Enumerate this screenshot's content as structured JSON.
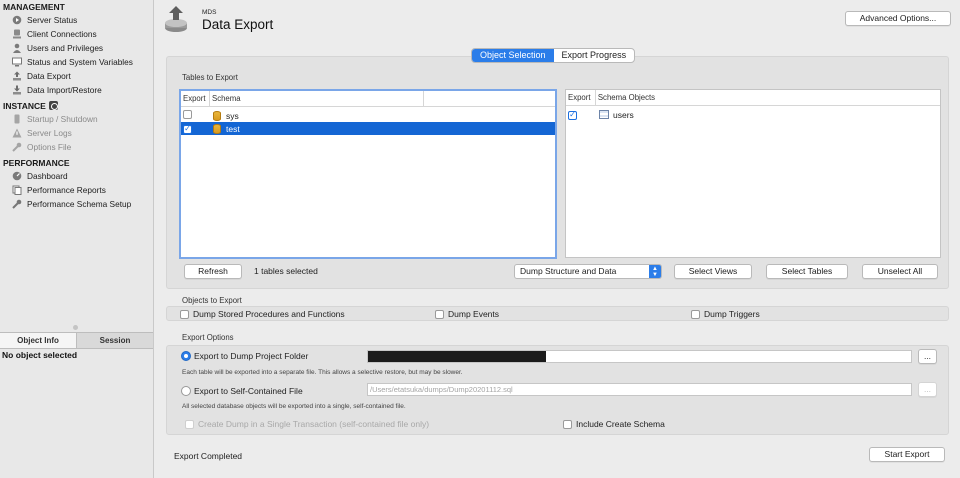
{
  "sidebar": {
    "management": {
      "title": "MANAGEMENT",
      "items": [
        {
          "label": "Server Status",
          "icon": "server-status-icon"
        },
        {
          "label": "Client Connections",
          "icon": "client-connections-icon"
        },
        {
          "label": "Users and Privileges",
          "icon": "user-icon"
        },
        {
          "label": "Status and System Variables",
          "icon": "monitor-icon"
        },
        {
          "label": "Data Export",
          "icon": "data-export-icon"
        },
        {
          "label": "Data Import/Restore",
          "icon": "data-import-icon"
        }
      ]
    },
    "instance": {
      "title": "INSTANCE",
      "items": [
        {
          "label": "Startup / Shutdown",
          "icon": "startup-icon"
        },
        {
          "label": "Server Logs",
          "icon": "warning-icon"
        },
        {
          "label": "Options File",
          "icon": "wrench-icon"
        }
      ]
    },
    "performance": {
      "title": "PERFORMANCE",
      "items": [
        {
          "label": "Dashboard",
          "icon": "dashboard-icon"
        },
        {
          "label": "Performance Reports",
          "icon": "reports-icon"
        },
        {
          "label": "Performance Schema Setup",
          "icon": "schema-setup-icon"
        }
      ]
    },
    "tabs": {
      "object_info": "Object Info",
      "session": "Session"
    },
    "no_object": "No object selected"
  },
  "header": {
    "subtitle": "MDS",
    "title": "Data Export",
    "advanced_options": "Advanced Options..."
  },
  "tabs": {
    "object_selection": "Object Selection",
    "export_progress": "Export Progress"
  },
  "tables_to_export": {
    "label": "Tables to Export",
    "left": {
      "col_export": "Export",
      "col_schema": "Schema",
      "rows": [
        {
          "name": "sys",
          "checked": false,
          "selected": false
        },
        {
          "name": "test",
          "checked": true,
          "selected": true
        }
      ]
    },
    "right": {
      "col_export": "Export",
      "col_objects": "Schema Objects",
      "rows": [
        {
          "name": "users",
          "checked": true
        }
      ]
    },
    "refresh": "Refresh",
    "selected_count": "1 tables selected",
    "dump_mode": "Dump Structure and Data",
    "select_views": "Select Views",
    "select_tables": "Select Tables",
    "unselect_all": "Unselect All"
  },
  "objects_to_export": {
    "label": "Objects to Export",
    "stored_procs": "Dump Stored Procedures and Functions",
    "events": "Dump Events",
    "triggers": "Dump Triggers"
  },
  "export_options": {
    "label": "Export Options",
    "to_folder": "Export to Dump Project Folder",
    "folder_hint": "Each table will be exported into a separate file. This allows a selective restore, but may be slower.",
    "to_file": "Export to Self-Contained File",
    "file_path": "/Users/etatsuka/dumps/Dump20201112.sql",
    "file_hint": "All selected database objects will be exported into a single, self-contained file.",
    "single_transaction": "Create Dump in a Single Transaction (self-contained file only)",
    "include_schema": "Include Create Schema",
    "browse": "..."
  },
  "footer": {
    "status": "Export Completed",
    "start_export": "Start Export"
  }
}
